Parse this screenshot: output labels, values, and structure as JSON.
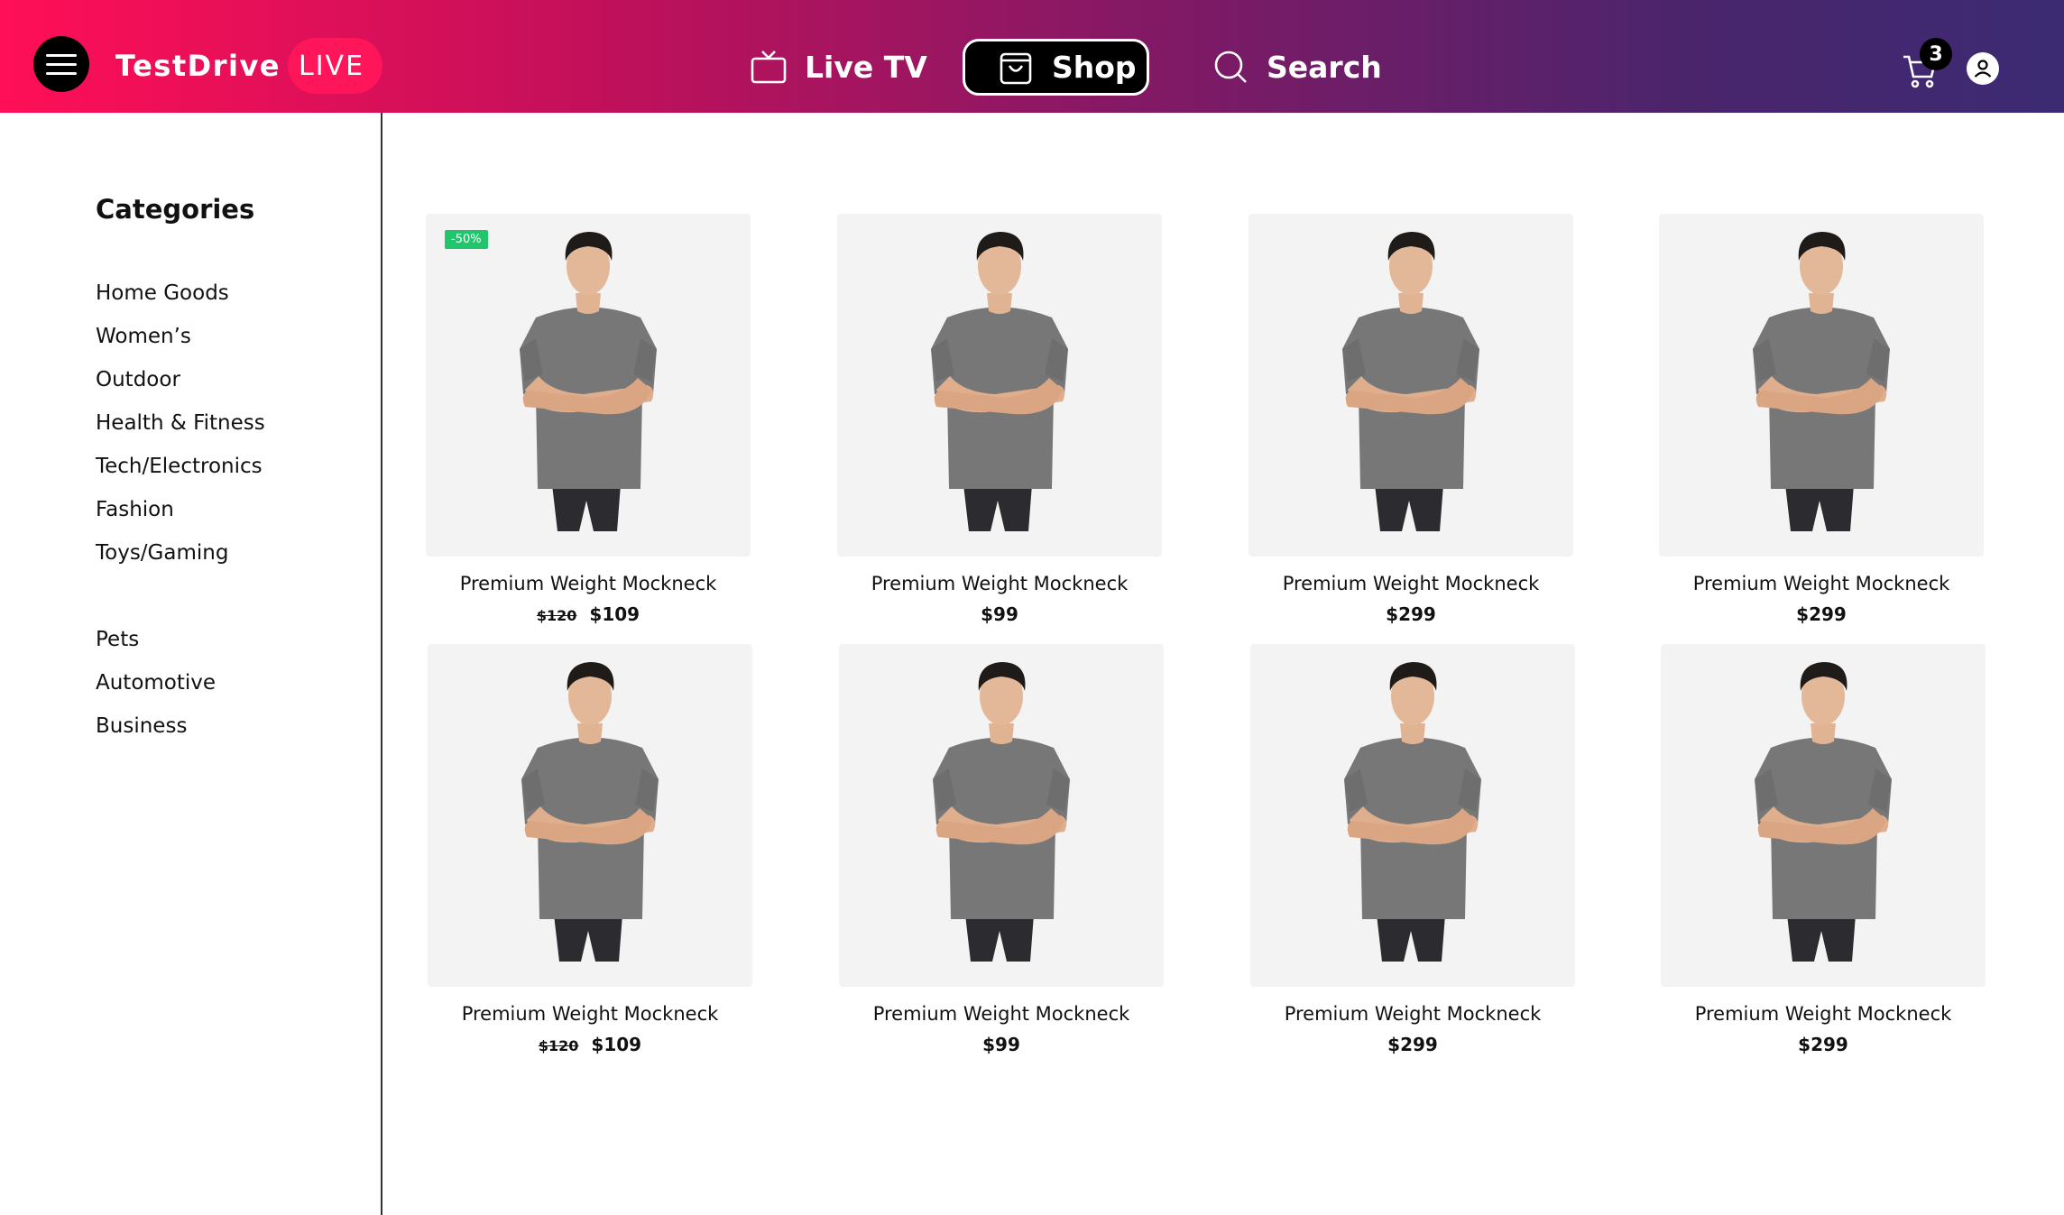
{
  "header": {
    "logo_text": "TestDrive",
    "logo_badge": "LIVE",
    "nav": {
      "live_tv": "Live TV",
      "shop": "Shop",
      "search": "Search"
    },
    "cart_count": "3",
    "colors": {
      "gradient_start": "#ff0f57",
      "gradient_end": "#3c2b73",
      "active_tab": "#000000"
    }
  },
  "sidebar": {
    "title": "Categories",
    "group1": [
      "Home Goods",
      "Women’s",
      "Outdoor",
      "Health & Fitness",
      "Tech/Electronics",
      "Fashion",
      "Toys/Gaming"
    ],
    "group2": [
      "Pets",
      "Automotive",
      "Business"
    ]
  },
  "products": [
    {
      "name": "Premium Weight Mockneck",
      "old_price": "$120",
      "price": "$109",
      "badge": "-50%"
    },
    {
      "name": "Premium Weight Mockneck",
      "old_price": "",
      "price": "$99",
      "badge": ""
    },
    {
      "name": "Premium Weight Mockneck",
      "old_price": "",
      "price": "$299",
      "badge": ""
    },
    {
      "name": "Premium Weight Mockneck",
      "old_price": "",
      "price": "$299",
      "badge": ""
    },
    {
      "name": "Premium Weight Mockneck",
      "old_price": "$120",
      "price": "$109",
      "badge": ""
    },
    {
      "name": "Premium Weight Mockneck",
      "old_price": "",
      "price": "$99",
      "badge": ""
    },
    {
      "name": "Premium Weight Mockneck",
      "old_price": "",
      "price": "$299",
      "badge": ""
    },
    {
      "name": "Premium Weight Mockneck",
      "old_price": "",
      "price": "$299",
      "badge": ""
    }
  ],
  "badge_color": "#21c56b"
}
